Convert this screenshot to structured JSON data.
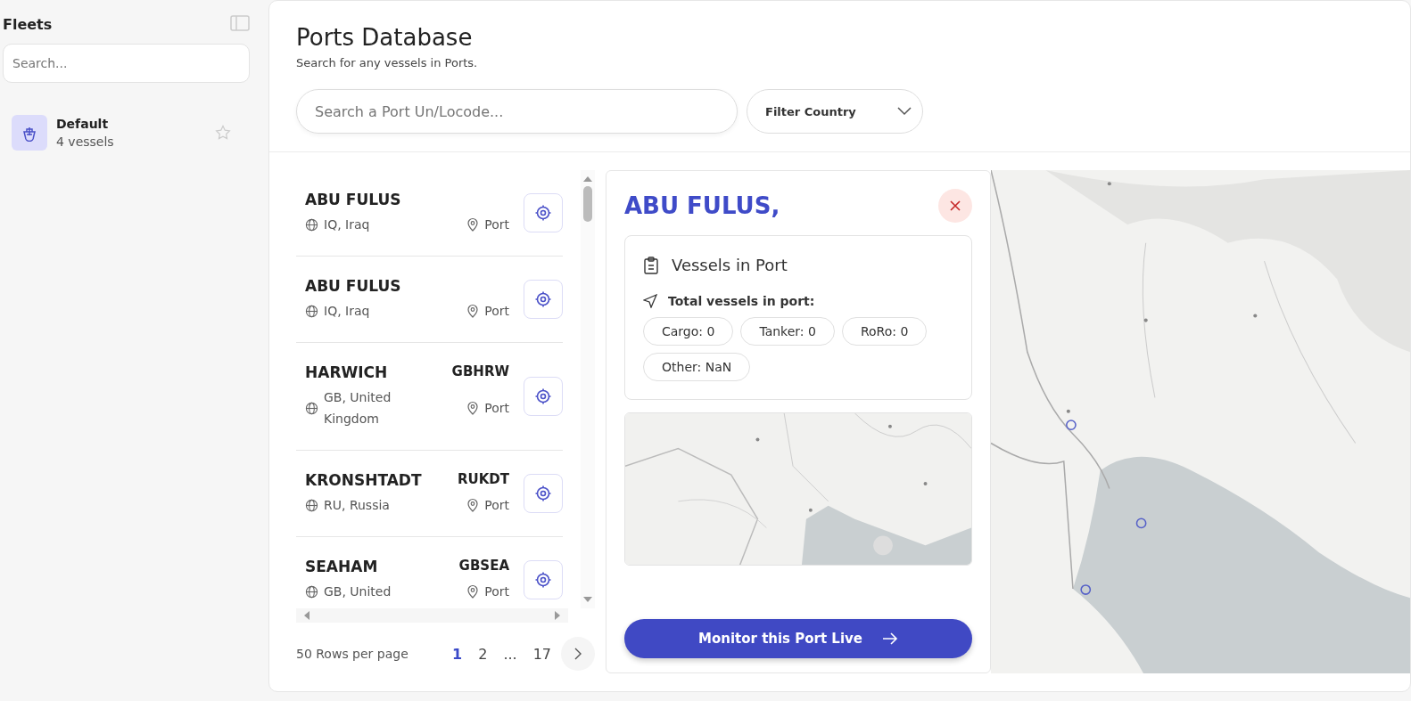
{
  "sidebar": {
    "title": "Fleets",
    "search": {
      "placeholder": "Search..."
    },
    "fleets": [
      {
        "name": "Default",
        "count": "4 vessels",
        "starred": false
      }
    ]
  },
  "header": {
    "title": "Ports Database",
    "subtitle": "Search for any vessels in Ports.",
    "search": {
      "placeholder": "Search a Port Un/Locode..."
    },
    "filter": {
      "label": "Filter Country"
    }
  },
  "ports": [
    {
      "name": "ABU FULUS",
      "country": "IQ, Iraq",
      "type": "Port"
    },
    {
      "name": "ABU FULUS",
      "country": "IQ, Iraq",
      "type": "Port"
    },
    {
      "name": "HARWICH",
      "code": "GBHRW",
      "country": "GB, United Kingdom",
      "type": "Port"
    },
    {
      "name": "KRONSHTADT",
      "code": "RUKDT",
      "country": "RU, Russia",
      "type": "Port"
    },
    {
      "name": "SEAHAM",
      "code": "GBSEA",
      "country": "GB, United",
      "type": "Port"
    }
  ],
  "pagination": {
    "rows_per_page": "50 Rows per page",
    "pages": [
      {
        "label": "1",
        "selected": true
      },
      {
        "label": "2",
        "selected": false
      },
      {
        "label": "...",
        "selected": false
      },
      {
        "label": "17",
        "selected": false
      }
    ]
  },
  "popup": {
    "title": "ABU FULUS,",
    "section_title": "Vessels in Port",
    "total_label": "Total vessels in port:",
    "counts": [
      "Cargo: 0",
      "Tanker: 0",
      "RoRo: 0",
      "Other: NaN"
    ],
    "button": "Monitor this Port Live"
  }
}
